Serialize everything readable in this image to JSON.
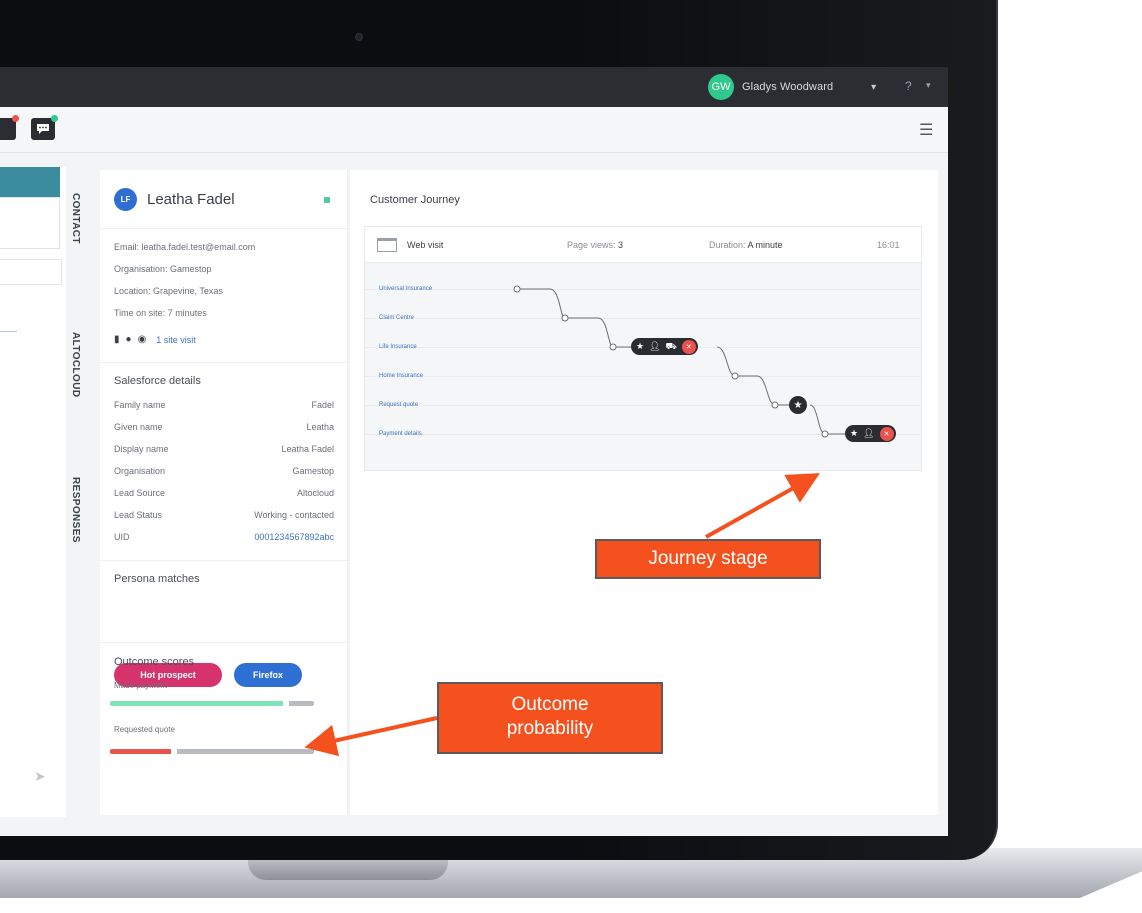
{
  "topbar": {
    "user_initial": "GW",
    "user_name": "Gladys Woodward",
    "chevron_icon": "▾",
    "help": "?",
    "help_chevron": "▾"
  },
  "toolbar": {
    "hamburger_icon": "☰"
  },
  "vertical_tabs": [
    "CONTACT",
    "ALTOCLOUD",
    "RESPONSES"
  ],
  "contact": {
    "initials": "LF",
    "name": "Leatha Fadel",
    "email": "Email: leatha.fadel.test@email.com",
    "organisation": "Organisation: Gamestop",
    "location": "Location: Grapevine, Texas",
    "time_on_site": "Time on site: 7 minutes",
    "device_icons": [
      "mobile-icon",
      "apple-icon",
      "chrome-icon"
    ],
    "site_visit": "1 site visit",
    "salesforce_title": "Salesforce details",
    "salesforce": [
      {
        "key": "Family name",
        "value": "Fadel"
      },
      {
        "key": "Given name",
        "value": "Leatha"
      },
      {
        "key": "Display name",
        "value": "Leatha Fadel"
      },
      {
        "key": "Organisation",
        "value": "Gamestop"
      },
      {
        "key": "Lead Source",
        "value": "Altocloud"
      },
      {
        "key": "Lead Status",
        "value": "Working - contacted"
      },
      {
        "key": "UID",
        "value": "0001234567892abc"
      }
    ],
    "persona_title": "Persona matches",
    "personas": [
      {
        "label": "Hot prospect",
        "color": "#d6336c"
      },
      {
        "label": "Firefox",
        "color": "#2f6fd3"
      }
    ],
    "outcome_title": "Outcome scores",
    "outcomes": [
      {
        "label": "Made payment",
        "probability": 0.85
      },
      {
        "label": "Requested quote",
        "probability": 0.3
      }
    ]
  },
  "journey": {
    "title": "Customer Journey",
    "visit_type": "Web visit",
    "page_views_label": "Page views:",
    "page_views": "3",
    "duration_label": "Duration:",
    "duration": "A minute",
    "time": "16:01",
    "stages": [
      "Universal Insurance",
      "Claim Centre",
      "Life Insurance",
      "Home Insurance",
      "Request quote",
      "Payment details"
    ]
  },
  "annotations": {
    "journey_stage": "Journey stage",
    "outcome_line1": "Outcome",
    "outcome_line2": "probability"
  },
  "colors": {
    "accent_orange": "#f4511e",
    "topbar": "#2b2d33",
    "score_green": "#7ee3b8",
    "score_red": "#e9524d",
    "score_grey": "#b8bbc0"
  }
}
